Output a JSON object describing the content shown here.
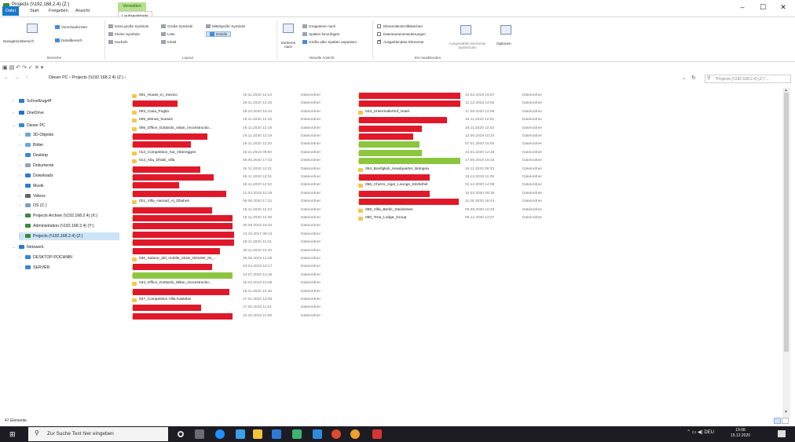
{
  "window": {
    "title": "Projects (\\\\192.168.2.4) (Z:)",
    "minimize": "–",
    "maximize": "☐",
    "close": "✕"
  },
  "ribbon_tabs": {
    "datei": "Datei",
    "start": "Start",
    "freigeben": "Freigeben",
    "ansicht": "Ansicht",
    "verwalten": "Verwalten",
    "laufwerkstools": "Laufwerktools"
  },
  "ribbon": {
    "bereiche": {
      "navigationsbereich": "Navigationsbereich",
      "vorschaufenster": "Vorschaufenster",
      "detailbereich": "Detailbereich",
      "label": "Bereiche"
    },
    "layout": {
      "extra_gross": "Extra große Symbole",
      "gross": "Große Symbole",
      "mittelgross": "Mittelgroße Symbole",
      "klein": "Kleine Symbole",
      "liste": "Liste",
      "details": "Details",
      "kacheln": "Kacheln",
      "inhalt": "Inhalt",
      "label": "Layout"
    },
    "aktuelle_ansicht": {
      "sortieren": "Sortieren nach",
      "gruppieren": "Gruppieren nach",
      "spalten": "Spalten hinzufügen",
      "groesse": "Größe aller Spalten anpassen",
      "label": "Aktuelle Ansicht"
    },
    "ein_ausblenden": {
      "kontrollkaestchen": "Elementkontrollkästchen",
      "erweiterungen": "Dateinamenerweiterungen",
      "ausgeblendete": "Ausgeblendete Elemente",
      "ausgewaehlte": "Ausgewählte Elemente ausblenden",
      "label": "Ein-/ausblenden"
    },
    "optionen": "Optionen"
  },
  "address": {
    "path": "Dieser PC  ›  Projects (\\\\192.168.2.4) (Z:)  ›",
    "search_placeholder": "\"Projects (\\\\192.168.2.4) (Z:)\"..."
  },
  "nav": [
    {
      "label": "Schnellzugriff",
      "color": "#2a7ad5"
    },
    {
      "label": "OneDrive",
      "color": "#1e73c9"
    },
    {
      "label": "Dieser PC",
      "color": "#3a86d6"
    },
    {
      "label": "3D-Objekte",
      "color": "#6aa8e0"
    },
    {
      "label": "Bilder",
      "color": "#6aa8e0"
    },
    {
      "label": "Desktop",
      "color": "#3a86d6"
    },
    {
      "label": "Dokumente",
      "color": "#9aa4b0"
    },
    {
      "label": "Downloads",
      "color": "#2a7ad5"
    },
    {
      "label": "Musik",
      "color": "#2a7ad5"
    },
    {
      "label": "Videos",
      "color": "#5c6670"
    },
    {
      "label": "OS (C:)",
      "color": "#7aa0c8"
    },
    {
      "label": "Projects Archive (\\\\192.168.2.4) (X:)",
      "color": "#3a8a3a"
    },
    {
      "label": "Administration (\\\\192.168.2.4) (Y:)",
      "color": "#3a8a3a"
    },
    {
      "label": "Projects (\\\\192.168.2.4) (Z:)",
      "color": "#3a8a3a"
    },
    {
      "label": "Netzwerk",
      "color": "#2a7ad5"
    },
    {
      "label": "DESKTOP-POCHNBI",
      "color": "#3a86d6"
    },
    {
      "label": "SERVER",
      "color": "#3a86d6"
    }
  ],
  "files_col1": [
    {
      "name": "001_House_in_mexico",
      "date": "19.11.2020 12:14",
      "type": "Dateiordner"
    },
    {
      "name": "",
      "date": "19.11.2020 12:15",
      "type": "Dateiordner"
    },
    {
      "name": "003_Casa_Puglia",
      "date": "28.10.2020 16:42",
      "type": "Dateiordner"
    },
    {
      "name": "005_Mimos_houses",
      "date": "19.11.2020 12:16",
      "type": "Dateiordner"
    },
    {
      "name": "006_Office_Gottardo_milan_reconstructio...",
      "date": "19.11.2020 12:18",
      "type": "Dateiordner"
    },
    {
      "name": "",
      "date": "19.11.2020 12:18",
      "type": "Dateiordner"
    },
    {
      "name": "",
      "date": "19.11.2020 12:20",
      "type": "Dateiordner"
    },
    {
      "name": "013_Competition_hut_Obereggen",
      "date": "16.11.2018 09:50",
      "type": "Dateiordner"
    },
    {
      "name": "014_Abu_Dhabi_villa",
      "date": "06.06.2020 17:22",
      "type": "Dateiordner"
    },
    {
      "name": "",
      "date": "19.11.2020 12:31",
      "type": "Dateiordner"
    },
    {
      "name": "",
      "date": "19.11.2020 12:31",
      "type": "Dateiordner"
    },
    {
      "name": "",
      "date": "19.11.2020 12:32",
      "type": "Dateiordner"
    },
    {
      "name": "",
      "date": "21.03.2018 10:16",
      "type": "Dateiordner"
    },
    {
      "name": "021_Villa_Hamad_Al_Dhaheri",
      "date": "06.06.2020 17:21",
      "type": "Dateiordner"
    },
    {
      "name": "",
      "date": "19.11.2020 12:34",
      "type": "Dateiordner"
    },
    {
      "name": "",
      "date": "19.11.2020 12:36",
      "type": "Dateiordner"
    },
    {
      "name": "",
      "date": "20.09.2018 16:32",
      "type": "Dateiordner"
    },
    {
      "name": "",
      "date": "13.10.2017 09:13",
      "type": "Dateiordner"
    },
    {
      "name": "",
      "date": "19.11.2020 12:41",
      "type": "Dateiordner"
    },
    {
      "name": "",
      "date": "19.11.2020 12:40",
      "type": "Dateiordner"
    },
    {
      "name": "030_Salone_del_mobile_2018_HOUSE_IN_...",
      "date": "25.05.2018 12:29",
      "type": "Dateiordner"
    },
    {
      "name": "",
      "date": "24.04.2019 10:17",
      "type": "Dateiordner"
    },
    {
      "name": "",
      "date": "13.07.2020 14:36",
      "type": "Dateiordner"
    },
    {
      "name": "034_Office_Gottardo_Milan_reconstructio...",
      "date": "18.04.2019 10:08",
      "type": "Dateiordner"
    },
    {
      "name": "",
      "date": "19.11.2020 12:46",
      "type": "Dateiordner"
    },
    {
      "name": "037_Competition Villa Kastelaz",
      "date": "17.01.2020 12:56",
      "type": "Dateiordner"
    },
    {
      "name": "",
      "date": "17.05.2018 11:01",
      "type": "Dateiordner"
    },
    {
      "name": "",
      "date": "10.10.2019 11:58",
      "type": "Dateiordner"
    }
  ],
  "files_col2": [
    {
      "name": "",
      "date": "22.02.2019 15:57",
      "type": "Dateiordner"
    },
    {
      "name": "",
      "date": "12.12.2018 14:53",
      "type": "Dateiordner"
    },
    {
      "name": "043_Untermullerhof_Hotel",
      "date": "17.08.2020 12:58",
      "type": "Dateiordner"
    },
    {
      "name": "",
      "date": "19.11.2020 12:51",
      "type": "Dateiordner"
    },
    {
      "name": "",
      "date": "19.11.2020 12:52",
      "type": "Dateiordner"
    },
    {
      "name": "",
      "date": "12.06.2019 10:24",
      "type": "Dateiordner"
    },
    {
      "name": "",
      "date": "07.01.2020 15:50",
      "type": "Dateiordner"
    },
    {
      "name": "",
      "date": "23.01.2020 12:45",
      "type": "Dateiordner"
    },
    {
      "name": "",
      "date": "17.09.2019 16:34",
      "type": "Dateiordner"
    },
    {
      "name": "054_Bonfiglioli_Headquarter_Bologna",
      "date": "19.11.2020 09:33",
      "type": "Dateiordner"
    },
    {
      "name": "",
      "date": "19.12.2019 11:25",
      "type": "Dateiordner"
    },
    {
      "name": "056_Chizzo_cigar_Lounge_Kitzbühel",
      "date": "01.12.2020 14:09",
      "type": "Dateiordner"
    },
    {
      "name": "",
      "date": "10.03.2020 09:36",
      "type": "Dateiordner"
    },
    {
      "name": "",
      "date": "11.06.2020 18:44",
      "type": "Dateiordner"
    },
    {
      "name": "059_Villa_Berlin_Steinitzsee",
      "date": "09.09.2020 16:48",
      "type": "Dateiordner"
    },
    {
      "name": "060_Tree_Lodge_Group",
      "date": "09.12.2020 13:27",
      "type": "Dateiordner"
    }
  ],
  "status": {
    "count": "47 Elemente"
  },
  "taskbar": {
    "search_placeholder": "Zur Suche Text hier eingeben",
    "lang": "DEU",
    "time": "19:08",
    "date": "15.12.2020"
  }
}
